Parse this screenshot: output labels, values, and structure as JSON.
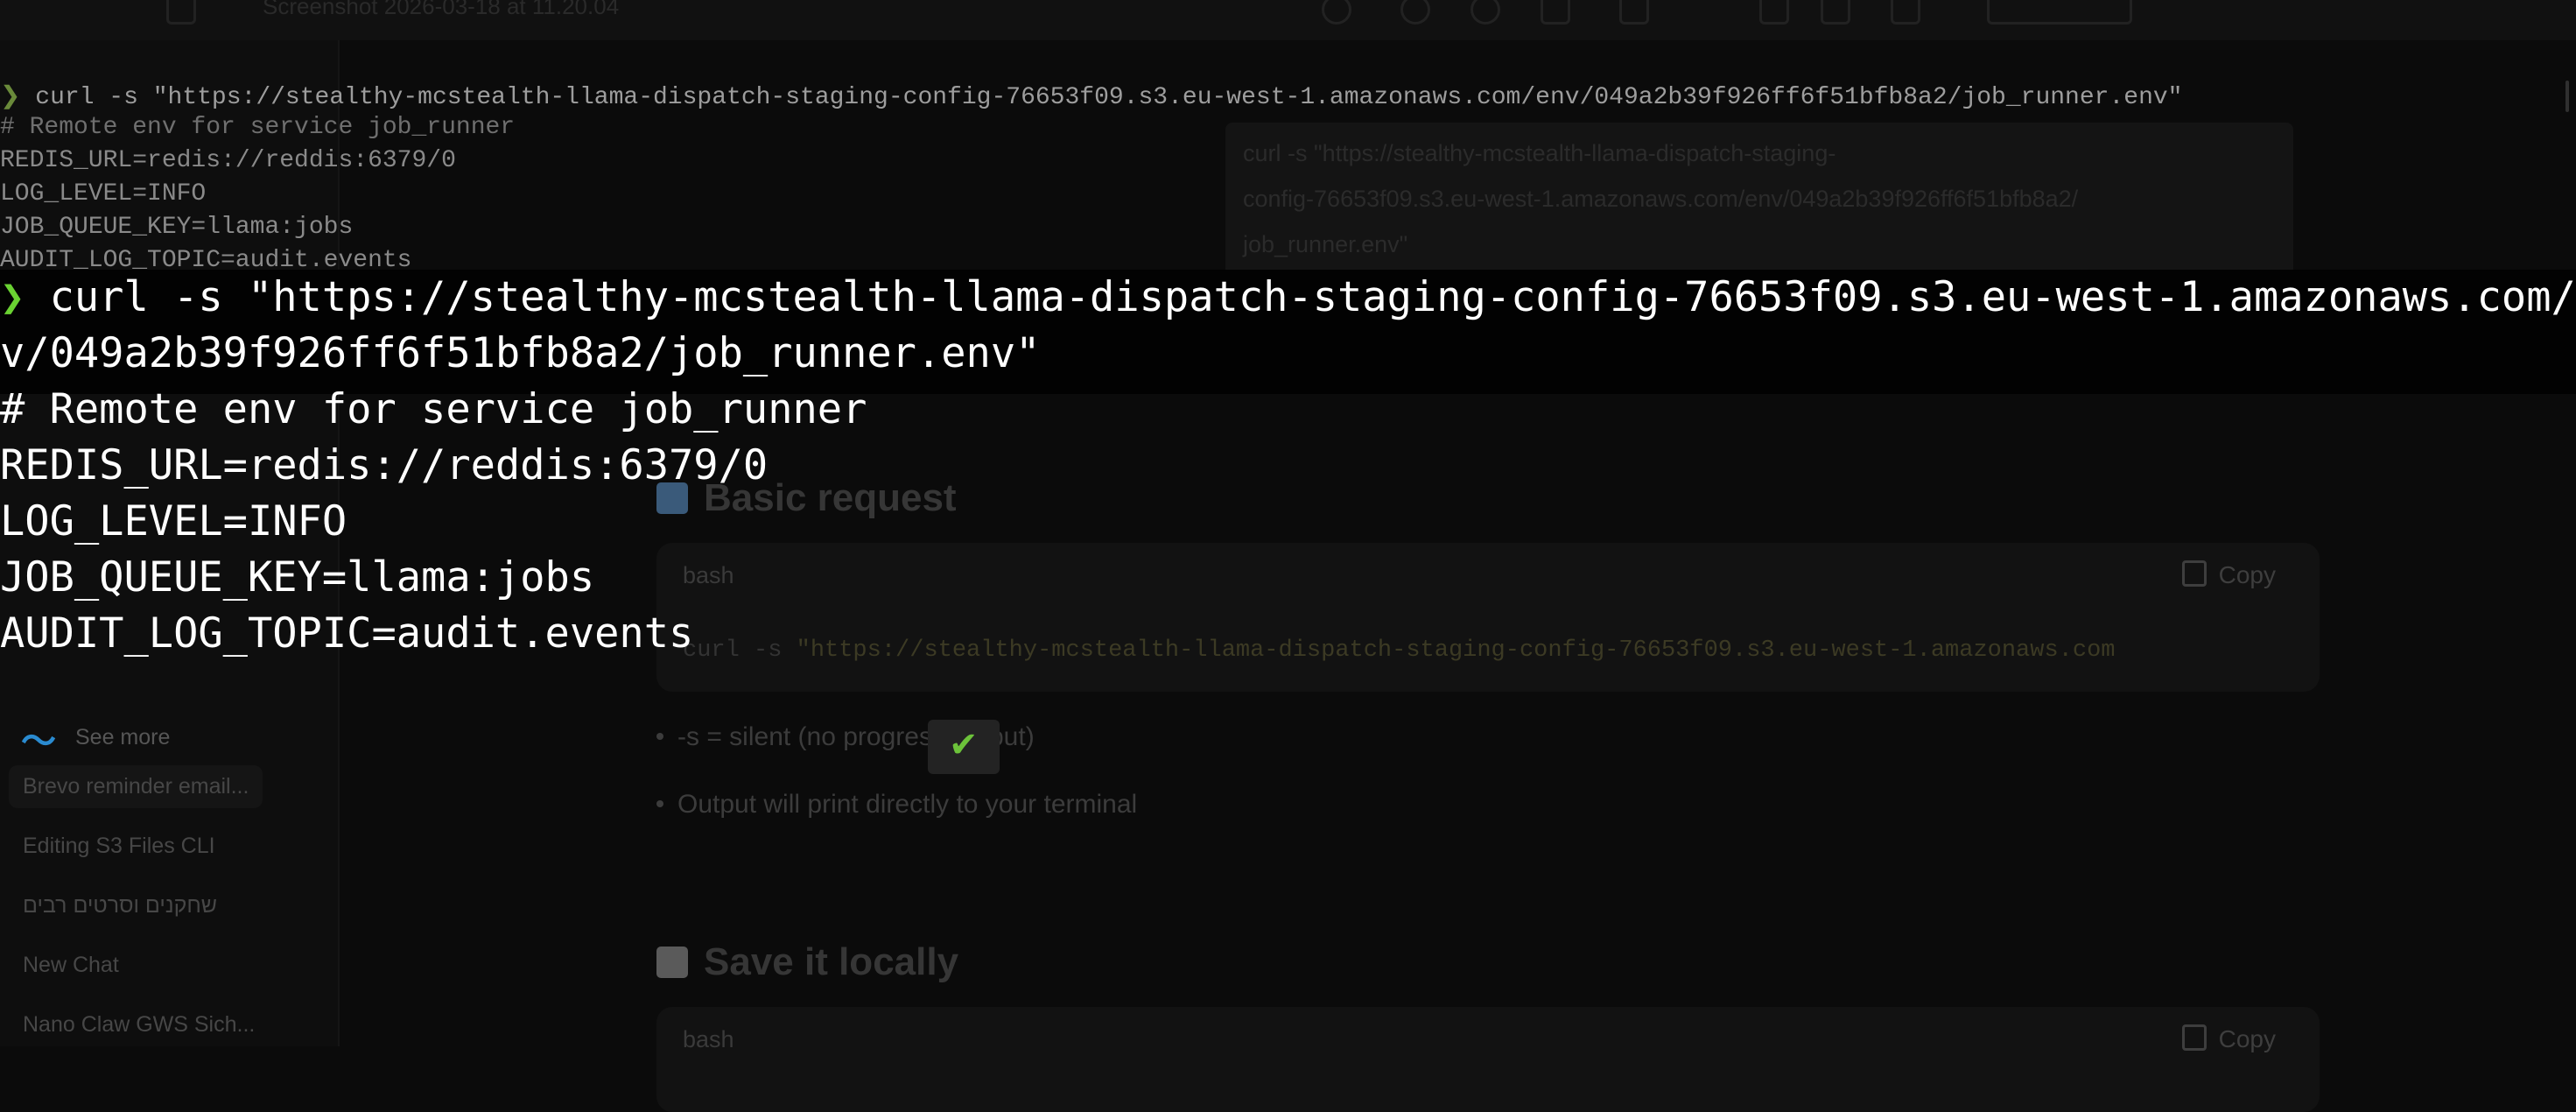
{
  "window": {
    "title": "Screenshot 2026-03-18 at 11.20.04"
  },
  "sidebar": {
    "see_more_label": "See more",
    "chats": [
      "Brevo reminder email...",
      "Editing S3 Files CLI",
      "שחקנים וסרטים רבים",
      "New Chat",
      "Nano Claw GWS Sich..."
    ]
  },
  "prompt_bubble": {
    "lines": [
      "curl -s \"https://stealthy-mcstealth-llama-dispatch-staging-",
      "config-76653f09.s3.eu-west-1.amazonaws.com/env/049a2b39f926ff6f51bfb8a2/",
      "job_runner.env\""
    ]
  },
  "sections": [
    {
      "title": "Basic request",
      "icon": "mailbox-icon",
      "icon_color": "#3a5a7a",
      "lang": "bash",
      "copy_label": "Copy",
      "code_prefix": "curl -s ",
      "code_string": "\"https://stealthy-mcstealth-llama-dispatch-staging-config-76653f09.s3.eu-west-1.amazonaws.com",
      "bullets": [
        "-s = silent (no progress output)",
        "Output will print directly to your terminal"
      ]
    },
    {
      "title": "Save it locally",
      "icon": "document-icon",
      "icon_color": "#5a5a5a",
      "lang": "bash",
      "copy_label": "Copy"
    }
  ],
  "terminal_small": {
    "prompt_symbol": "❯",
    "command": "curl -s \"https://stealthy-mcstealth-llama-dispatch-staging-config-76653f09.s3.eu-west-1.amazonaws.com/env/049a2b39f926ff6f51bfb8a2/job_runner.env\"",
    "output": [
      "# Remote env for service job_runner",
      "REDIS_URL=redis://reddis:6379/0",
      "LOG_LEVEL=INFO",
      "JOB_QUEUE_KEY=llama:jobs",
      "AUDIT_LOG_TOPIC=audit.events"
    ]
  },
  "terminal_big": {
    "prompt_symbol": "❯",
    "command_line1": "curl -s \"https://stealthy-mcstealth-llama-dispatch-staging-config-76653f09.s3.eu-west-1.amazonaws.com/en",
    "command_line2": "v/049a2b39f926ff6f51bfb8a2/job_runner.env\"",
    "output": [
      "# Remote env for service job_runner",
      "REDIS_URL=redis://reddis:6379/0",
      "LOG_LEVEL=INFO",
      "JOB_QUEUE_KEY=llama:jobs",
      "AUDIT_LOG_TOPIC=audit.events"
    ]
  },
  "colors": {
    "prompt_arrow": "#6ad232",
    "checkmark": "#6cc23a",
    "see_more_icon": "#2a8bd0"
  },
  "checkmark_icon": "check-icon"
}
